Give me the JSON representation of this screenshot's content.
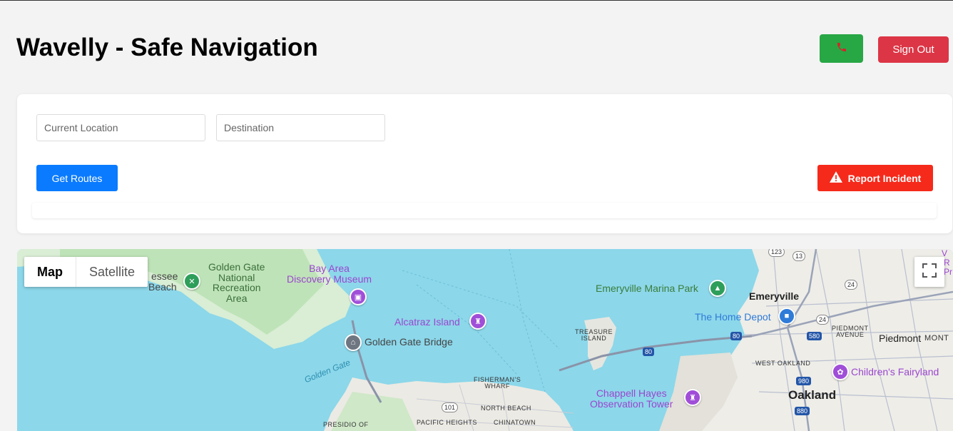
{
  "header": {
    "title": "Wavelly - Safe Navigation",
    "call_icon": "phone-icon",
    "signout_label": "Sign Out"
  },
  "form": {
    "current_placeholder": "Current Location",
    "destination_placeholder": "Destination",
    "get_routes_label": "Get Routes",
    "report_label": "Report Incident",
    "report_icon": "warning-icon"
  },
  "map": {
    "type_map_label": "Map",
    "type_satellite_label": "Satellite",
    "fullscreen_icon": "fullscreen-icon",
    "labels": {
      "essee_beach_1": "essee",
      "essee_beach_2": "Beach",
      "ggnra": "Golden Gate\nNational\nRecreation\nArea",
      "bay_area_discovery": "Bay Area\nDiscovery Museum",
      "alcatraz": "Alcatraz Island",
      "golden_gate_bridge": "Golden Gate Bridge",
      "golden_gate_water": "Golden Gate",
      "treasure_island": "TREASURE\nISLAND",
      "fishermans_wharf": "FISHERMAN'S\nWHARF",
      "north_beach": "NORTH BEACH",
      "pacific_heights": "PACIFIC HEIGHTS",
      "chinatown": "CHINATOWN",
      "presidio": "PRESIDIO OF",
      "emeryville_marina": "Emeryville Marina Park",
      "emeryville": "Emeryville",
      "home_depot": "The Home Depot",
      "piedmont_avenue": "PIEDMONT\nAVENUE",
      "piedmont": "Piedmont",
      "mont": "MONT",
      "west_oakland": "WEST OAKLAND",
      "childrens_fairyland": "Children's Fairyland",
      "oakland": "Oakland",
      "chappell_hayes": "Chappell Hayes\nObservation Tower",
      "corner_v": "V",
      "corner_r": "R",
      "corner_p": "Pr"
    },
    "shields": {
      "s123": "123",
      "s13": "13",
      "s24a": "24",
      "s24b": "24",
      "s80a": "80",
      "s80b": "80",
      "s580": "580",
      "s980": "980",
      "s880": "880",
      "s101": "101"
    }
  }
}
